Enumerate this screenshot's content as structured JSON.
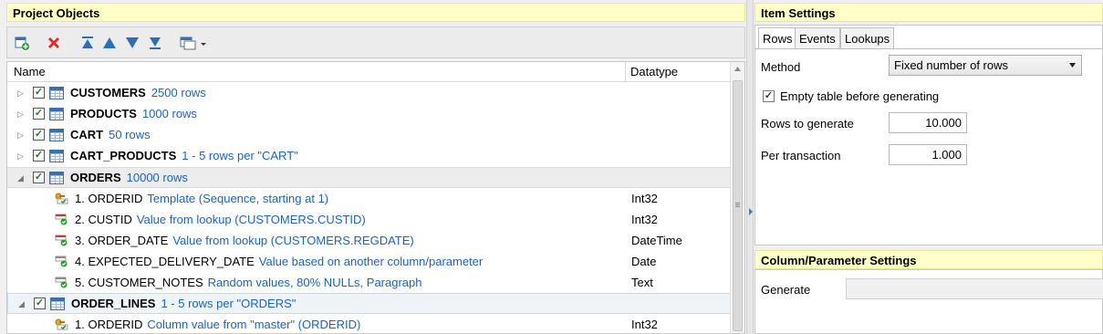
{
  "left_panel": {
    "title": "Project Objects",
    "toolbar": {
      "add_icon": "add-table-icon",
      "delete_icon": "delete-icon",
      "move_top_icon": "move-top-icon",
      "move_up_icon": "move-up-icon",
      "move_down_icon": "move-down-icon",
      "move_bottom_icon": "move-bottom-icon",
      "view_options_icon": "view-options-icon"
    },
    "columns": {
      "name": "Name",
      "datatype": "Datatype"
    },
    "rows": [
      {
        "kind": "table",
        "name": "CUSTOMERS",
        "desc": "2500 rows",
        "checked": "✓",
        "expanded": "▷"
      },
      {
        "kind": "table",
        "name": "PRODUCTS",
        "desc": "1000 rows",
        "checked": "✓",
        "expanded": "▷"
      },
      {
        "kind": "table",
        "name": "CART",
        "desc": "50 rows",
        "checked": "✓",
        "expanded": "▷"
      },
      {
        "kind": "table",
        "name": "CART_PRODUCTS",
        "desc": "1 - 5 rows per \"CART\"",
        "checked": "✓",
        "expanded": "▷"
      },
      {
        "kind": "table",
        "name": "ORDERS",
        "desc": "10000 rows",
        "checked": "✓",
        "expanded": "◢"
      },
      {
        "kind": "column",
        "name": "1. ORDERID",
        "desc": "Template (Sequence, starting at 1)",
        "datatype": "Int32",
        "icon": "key-column-icon"
      },
      {
        "kind": "column",
        "name": "2. CUSTID",
        "desc": "Value from lookup (CUSTOMERS.CUSTID)",
        "datatype": "Int32",
        "icon": "lookup-column-icon"
      },
      {
        "kind": "column",
        "name": "3. ORDER_DATE",
        "desc": "Value from lookup (CUSTOMERS.REGDATE)",
        "datatype": "DateTime",
        "icon": "lookup-column-icon"
      },
      {
        "kind": "column",
        "name": "4. EXPECTED_DELIVERY_DATE",
        "desc": "Value based on another column/parameter",
        "datatype": "Date",
        "icon": "column-icon"
      },
      {
        "kind": "column",
        "name": "5. CUSTOMER_NOTES",
        "desc": "Random values, 80% NULLs, Paragraph",
        "datatype": "Text",
        "icon": "column-icon"
      },
      {
        "kind": "table",
        "name": "ORDER_LINES",
        "desc": "1 - 5 rows per \"ORDERS\"",
        "checked": "✓",
        "expanded": "◢"
      },
      {
        "kind": "column",
        "name": "1. ORDERID",
        "desc": "Column value from \"master\" (ORDERID)",
        "datatype": "Int32",
        "icon": "key-column-icon"
      }
    ]
  },
  "right_panel": {
    "title": "Item Settings",
    "tabs": [
      "Rows",
      "Events",
      "Lookups"
    ],
    "active_tab": "Rows",
    "method_label": "Method",
    "method_value": "Fixed number of rows",
    "empty_table_label": "Empty table before generating",
    "empty_table_checked": "✓",
    "rows_to_generate_label": "Rows to generate",
    "rows_to_generate_value": "10.000",
    "per_transaction_label": "Per transaction",
    "per_transaction_value": "1.000",
    "colparam_title": "Column/Parameter Settings",
    "generate_label": "Generate",
    "generate_value": ""
  },
  "colors": {
    "title_bg": "#ffffc8",
    "link_blue": "#1c64b4",
    "check_green": "#1f7a1f"
  }
}
